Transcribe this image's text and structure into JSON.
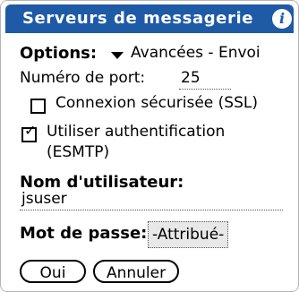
{
  "header": {
    "title": "Serveurs de messagerie",
    "info_icon_glyph": "i",
    "background_color": "#1e5aa6"
  },
  "options": {
    "label": "Options:",
    "value": "Avancées - Envoi"
  },
  "port": {
    "label": "Numéro de port:",
    "value": "25"
  },
  "ssl": {
    "label": "Connexion sécurisée (SSL)",
    "checked": false
  },
  "auth": {
    "label_line1": "Utiliser authentification",
    "label_line2": "(ESMTP)",
    "checked": true,
    "check_glyph": "✓"
  },
  "username": {
    "label": "Nom d'utilisateur:",
    "value": "jsuser"
  },
  "password": {
    "label": "Mot de passe:",
    "value": "-Attribué-"
  },
  "buttons": {
    "ok": "Oui",
    "cancel": "Annuler"
  }
}
